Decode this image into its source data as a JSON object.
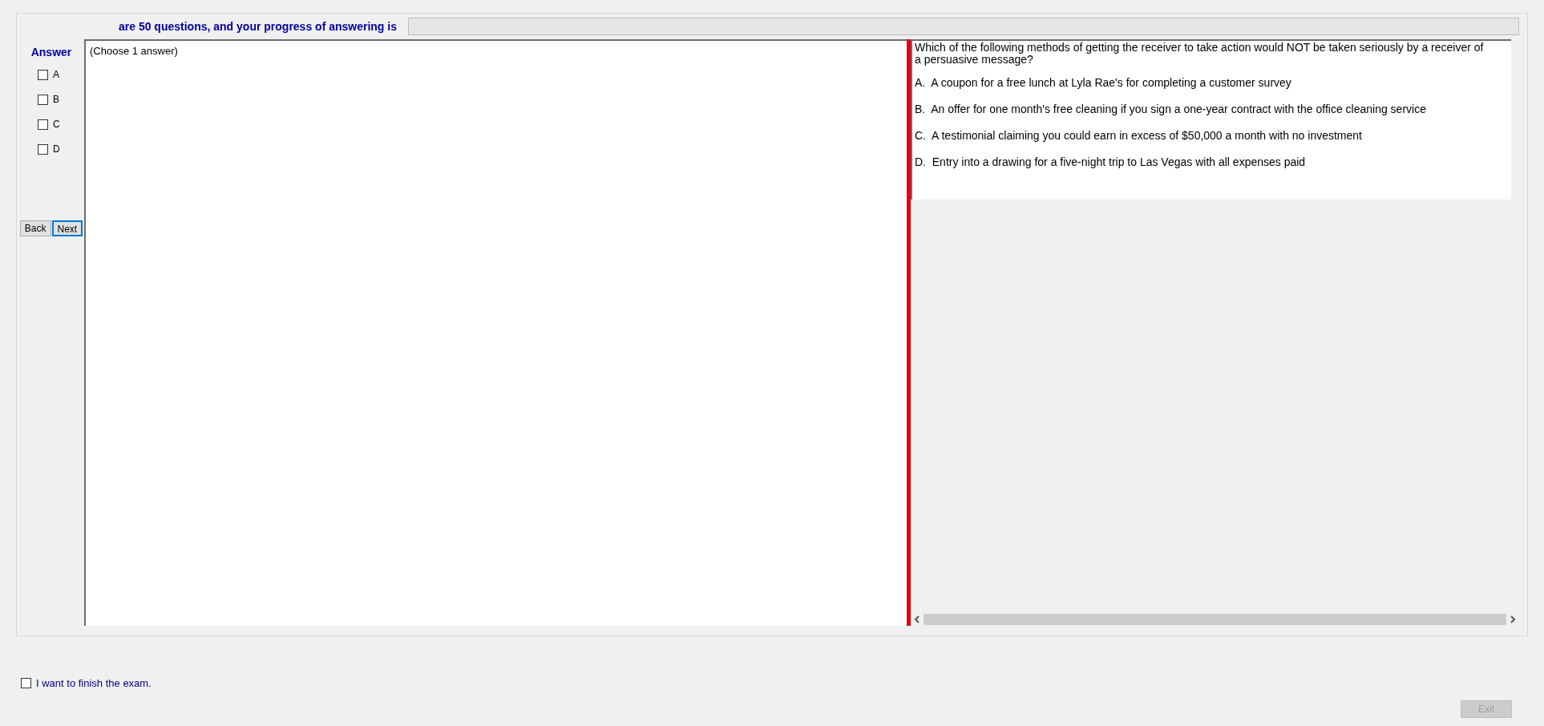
{
  "header": {
    "text": "are 50 questions, and your progress of answering is",
    "progress": {
      "level": 0
    }
  },
  "answer_panel": {
    "title": "Answer",
    "options": [
      {
        "label": "A",
        "checked": false
      },
      {
        "label": "B",
        "checked": false
      },
      {
        "label": "C",
        "checked": false
      },
      {
        "label": "D",
        "checked": false
      }
    ],
    "buttons": [
      {
        "label": "Back",
        "focused": false
      },
      {
        "label": "Next",
        "focused": true
      }
    ]
  },
  "instruction": "(Choose 1 answer)",
  "question": {
    "text": "Which of the following methods of getting the receiver to take action would NOT be taken seriously by a receiver of a persuasive message?",
    "choices": [
      "A.  A coupon for a free lunch at Lyla Rae's for completing a customer survey",
      "B.  An offer for one month's free cleaning if you sign a one-year contract with the office cleaning service",
      "C.  A testimonial claiming you could earn in excess of $50,000 a month with no investment",
      "D.  Entry into a drawing for a five-night trip to Las Vegas with all expenses paid"
    ]
  },
  "finish": {
    "label": "I want to finish the exam.",
    "checked": false
  },
  "exit_button": {
    "label": "Exit",
    "disabled": true
  }
}
